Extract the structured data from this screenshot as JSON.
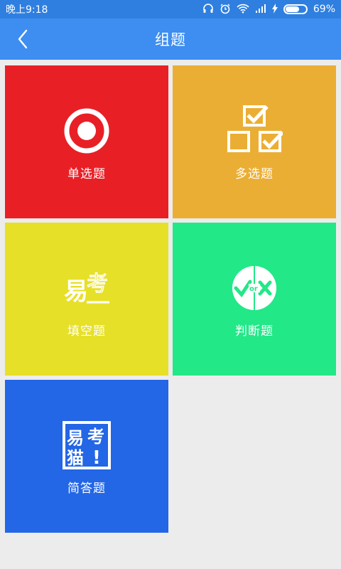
{
  "status_bar": {
    "time": "晚上9:18",
    "battery_percent": "69%",
    "battery_level": 0.69
  },
  "header": {
    "title": "组题",
    "back_icon": "chevron-left-icon"
  },
  "tiles": [
    {
      "label": "单选题",
      "color": "#e82026",
      "icon": "radio-button-icon"
    },
    {
      "label": "多选题",
      "color": "#ebae34",
      "icon": "checkboxes-icon"
    },
    {
      "label": "填空题",
      "color": "#e7e028",
      "icon": "fill-blank-icon",
      "icon_text": "易 考"
    },
    {
      "label": "判断题",
      "color": "#22e888",
      "icon": "true-or-false-icon",
      "icon_text": "or"
    },
    {
      "label": "简答题",
      "color": "#2366e6",
      "icon": "short-answer-icon",
      "icon_text": "易 考 猫 !"
    }
  ]
}
